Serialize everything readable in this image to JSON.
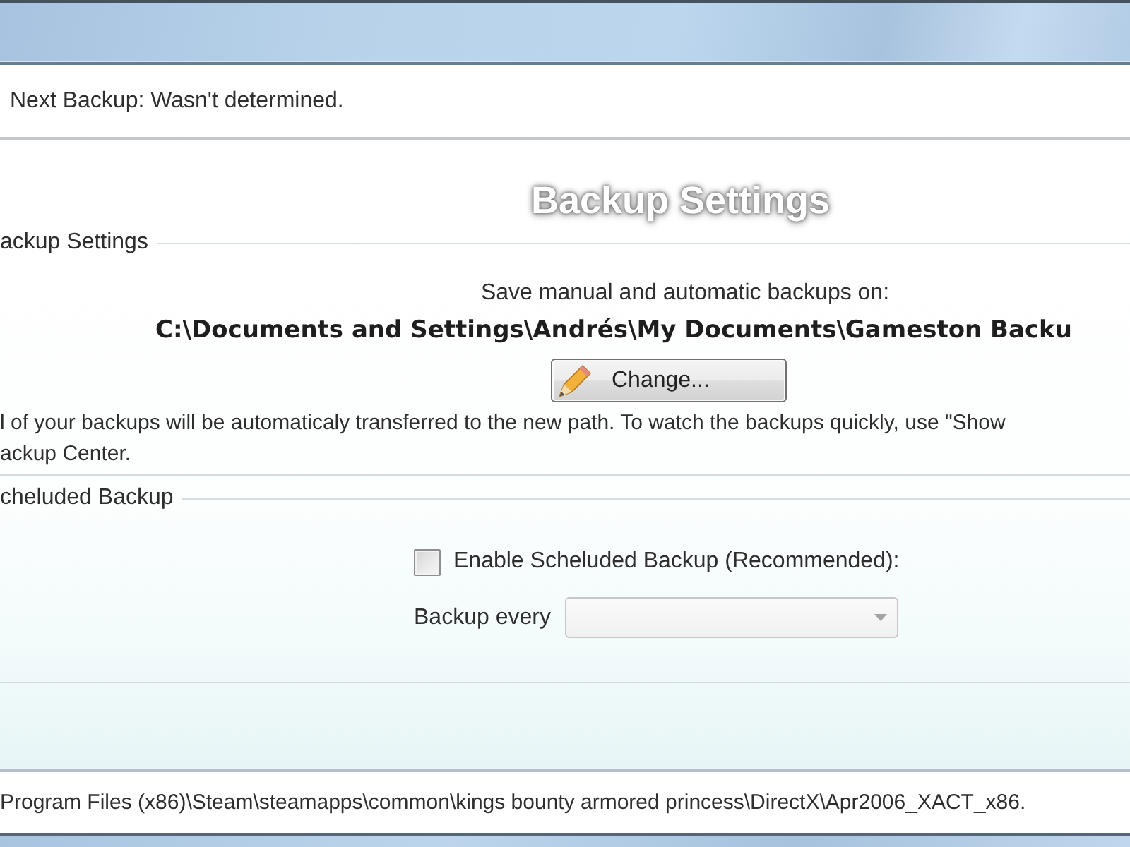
{
  "info_bar": {
    "text": "Next Backup: Wasn't determined."
  },
  "heading": "Backup Settings",
  "groups": [
    {
      "kind": "location",
      "title": "ackup Settings",
      "prompt": "Save manual and automatic backups on:",
      "path": "C:\\Documents and Settings\\Andrés\\My Documents\\Gameston Backu",
      "button": "Change...",
      "note_lines": [
        "l of your backups will be automaticaly transferred to the new path. To watch the backups quickly, use \"Show",
        "ackup Center."
      ]
    },
    {
      "kind": "schedule",
      "title": "cheluded Backup",
      "checkbox": {
        "label": "Enable Scheluded Backup (Recommended):",
        "checked": false
      },
      "interval": {
        "label": "Backup every",
        "disabled": true
      }
    }
  ],
  "status_bar": {
    "text": "Program Files (x86)\\Steam\\steamapps\\common\\kings bounty armored princess\\DirectX\\Apr2006_XACT_x86."
  }
}
